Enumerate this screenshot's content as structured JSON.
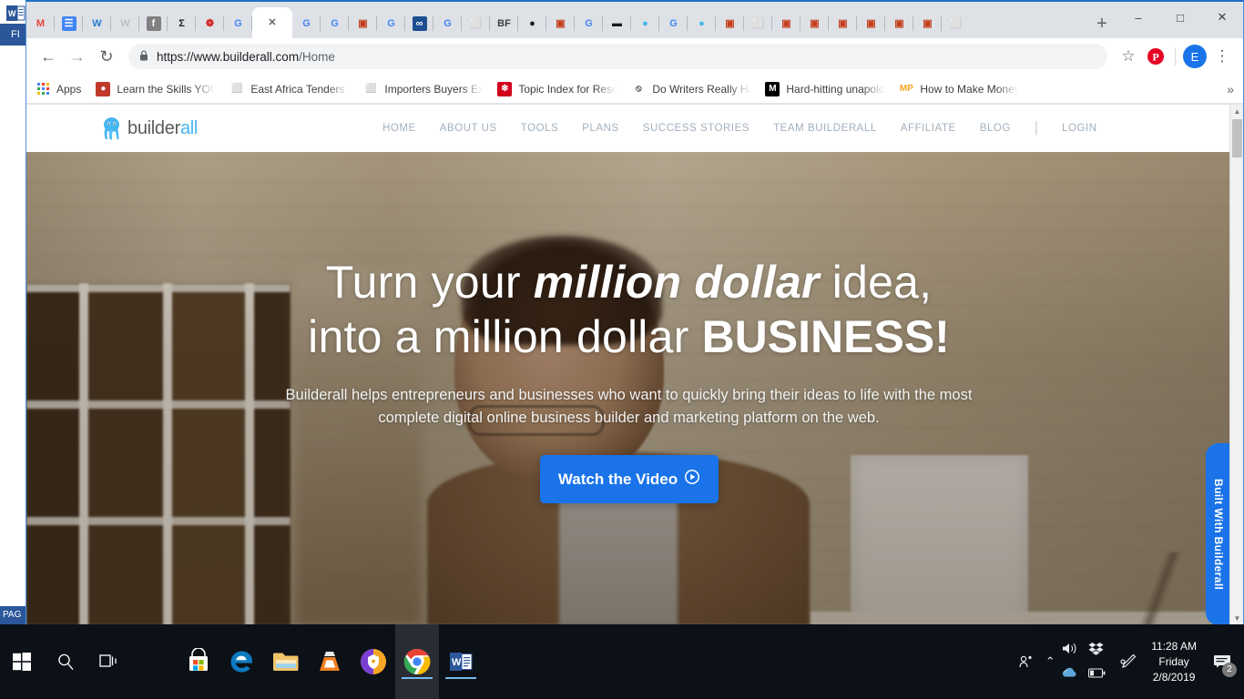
{
  "desktop": {
    "background_window": {
      "app": "Microsoft Word",
      "ribbon_tab_label": "FI",
      "status_label": "PAG"
    }
  },
  "browser": {
    "window_controls": {
      "minimize": "–",
      "maximize": "□",
      "close": "✕"
    },
    "tabs": [
      {
        "favicon": "gmail-icon",
        "glyph": "M",
        "color": "#ea4335",
        "active": false
      },
      {
        "favicon": "google-docs-icon",
        "glyph": "☰",
        "color": "#ffffff",
        "bg": "#4285f4",
        "active": false
      },
      {
        "favicon": "word-icon",
        "glyph": "W",
        "color": "#2b7cd3",
        "active": false
      },
      {
        "favicon": "word-gray-icon",
        "glyph": "W",
        "color": "#bdc1c6",
        "active": false
      },
      {
        "favicon": "facebook-icon",
        "glyph": "f",
        "color": "#ffffff",
        "bg": "#808080",
        "active": false
      },
      {
        "favicon": "chevron-logo-icon",
        "glyph": "Σ",
        "color": "#1a1a1a",
        "active": false
      },
      {
        "favicon": "red-logo-icon",
        "glyph": "❁",
        "color": "#d32f2f",
        "active": false
      },
      {
        "favicon": "google-icon",
        "glyph": "G",
        "color": "#4285f4",
        "active": false
      },
      {
        "favicon": "close-icon",
        "glyph": "✕",
        "color": "#5f6368",
        "active": true
      },
      {
        "favicon": "google-icon",
        "glyph": "G",
        "color": "#4285f4",
        "active": false
      },
      {
        "favicon": "google-icon",
        "glyph": "G",
        "color": "#4285f4",
        "active": false
      },
      {
        "favicon": "powerpoint-icon",
        "glyph": "▣",
        "color": "#c43e1c",
        "active": false
      },
      {
        "favicon": "google-icon",
        "glyph": "G",
        "color": "#4285f4",
        "active": false
      },
      {
        "favicon": "infinity-icon",
        "glyph": "∞",
        "color": "#ffffff",
        "bg": "#1d4f91",
        "active": false
      },
      {
        "favicon": "google-icon",
        "glyph": "G",
        "color": "#4285f4",
        "active": false
      },
      {
        "favicon": "blank-page-icon",
        "glyph": "⬜",
        "color": "#9aa0a6",
        "active": false
      },
      {
        "favicon": "bigfoot-icon",
        "glyph": "BF",
        "color": "#3c4043",
        "active": false
      },
      {
        "favicon": "ninja-icon",
        "glyph": "●",
        "color": "#1a1a1a",
        "active": false
      },
      {
        "favicon": "powerpoint-icon",
        "glyph": "▣",
        "color": "#c43e1c",
        "active": false
      },
      {
        "favicon": "google-icon",
        "glyph": "G",
        "color": "#4285f4",
        "active": false
      },
      {
        "favicon": "dark-logo-icon",
        "glyph": "▬",
        "color": "#1a1a1a",
        "active": false
      },
      {
        "favicon": "builderall-icon",
        "glyph": "●",
        "color": "#45b6f0",
        "active": false
      },
      {
        "favicon": "google-icon",
        "glyph": "G",
        "color": "#4285f4",
        "active": false
      },
      {
        "favicon": "builderall-icon",
        "glyph": "●",
        "color": "#45b6f0",
        "active": false
      },
      {
        "favicon": "powerpoint-icon",
        "glyph": "▣",
        "color": "#c43e1c",
        "active": false
      },
      {
        "favicon": "blank-page-icon",
        "glyph": "⬜",
        "color": "#9aa0a6",
        "active": false
      },
      {
        "favicon": "powerpoint-icon",
        "glyph": "▣",
        "color": "#c43e1c",
        "active": false
      },
      {
        "favicon": "powerpoint-icon",
        "glyph": "▣",
        "color": "#c43e1c",
        "active": false
      },
      {
        "favicon": "powerpoint-icon",
        "glyph": "▣",
        "color": "#c43e1c",
        "active": false
      },
      {
        "favicon": "powerpoint-icon",
        "glyph": "▣",
        "color": "#c43e1c",
        "active": false
      },
      {
        "favicon": "powerpoint-icon",
        "glyph": "▣",
        "color": "#c43e1c",
        "active": false
      },
      {
        "favicon": "powerpoint-icon",
        "glyph": "▣",
        "color": "#c43e1c",
        "active": false
      },
      {
        "favicon": "blank-page-icon",
        "glyph": "⬜",
        "color": "#9aa0a6",
        "active": false
      }
    ],
    "new_tab_label": "+",
    "toolbar": {
      "back": "←",
      "forward": "→",
      "reload": "↻",
      "lock_icon": "🔒",
      "url_host": "https://www.builderall.com",
      "url_path": "/Home",
      "bookmark_star": "☆",
      "pinterest_label": "P",
      "profile_initial": "E",
      "menu": "⋮"
    },
    "bookmarks": {
      "apps_label": "Apps",
      "overflow": "»",
      "items": [
        {
          "label": "Learn the Skills YOU ",
          "icon": "red-circle-icon",
          "glyph": "●",
          "fg": "#ffffff",
          "bg": "#c0392b"
        },
        {
          "label": "East Africa Tenders -",
          "icon": "page-icon",
          "glyph": "⬜",
          "fg": "#9aa0a6",
          "bg": "transparent"
        },
        {
          "label": "Importers Buyers Exp",
          "icon": "page-icon",
          "glyph": "⬜",
          "fg": "#9aa0a6",
          "bg": "transparent"
        },
        {
          "label": "Topic Index for Resou",
          "icon": "red-square-icon",
          "glyph": "❄",
          "fg": "#ffffff",
          "bg": "#d0021b"
        },
        {
          "label": "Do Writers Really Hav",
          "icon": "no-entry-icon",
          "glyph": "⦸",
          "fg": "#3c4043",
          "bg": "transparent"
        },
        {
          "label": "Hard-hitting unapolo",
          "icon": "medium-icon",
          "glyph": "M",
          "fg": "#ffffff",
          "bg": "#000000"
        },
        {
          "label": "How to Make Money",
          "icon": "mp-icon",
          "glyph": "MP",
          "fg": "#f5a623",
          "bg": "#ffffff"
        }
      ]
    },
    "scrollbar": {
      "up_arrow": "▲",
      "down_arrow": "▼"
    }
  },
  "site": {
    "brand": {
      "part1": "builder",
      "part2": "all",
      "logo_icon": "octopus-icon"
    },
    "nav": [
      {
        "label": "HOME"
      },
      {
        "label": "ABOUT US"
      },
      {
        "label": "TOOLS"
      },
      {
        "label": "PLANS"
      },
      {
        "label": "SUCCESS STORIES"
      },
      {
        "label": "TEAM BUILDERALL"
      },
      {
        "label": "AFFILIATE"
      },
      {
        "label": "BLOG"
      }
    ],
    "nav_divider": "|",
    "login_label": "LOGIN",
    "hero": {
      "headline_line1_a": "Turn your ",
      "headline_line1_em": "million dollar",
      "headline_line1_b": " idea,",
      "headline_line2_a": "into a million dollar ",
      "headline_line2_strong": "BUSINESS!",
      "subtitle": "Builderall helps entrepreneurs and businesses who want to quickly bring their ideas to life with the most complete digital online business builder and marketing platform on the web.",
      "cta_label": "Watch the Video",
      "cta_icon": "▶",
      "accent_color": "#1a73e8"
    },
    "side_tab_label": "Built With Builderall"
  },
  "taskbar": {
    "start_label": "⊞",
    "search_label": "⌕",
    "taskview_label": "⌸",
    "apps": [
      {
        "name": "microsoft-store-icon",
        "glyph": "▣",
        "running": false
      },
      {
        "name": "microsoft-edge-icon",
        "glyph": "e",
        "running": false
      },
      {
        "name": "file-explorer-icon",
        "glyph": "⬛",
        "running": false
      },
      {
        "name": "vlc-media-player-icon",
        "glyph": "▲",
        "running": false
      },
      {
        "name": "avast-browser-icon",
        "glyph": "●",
        "running": false
      },
      {
        "name": "google-chrome-icon",
        "glyph": "●",
        "running": true,
        "active": true
      },
      {
        "name": "microsoft-word-icon",
        "glyph": "W",
        "running": true,
        "active": false
      }
    ],
    "tray": {
      "people_icon": "⚹",
      "chevron_up": "⌃",
      "volume_icon": "🔊",
      "dropbox_icon": "❖",
      "onedrive_icon": "☁",
      "battery_icon": "▭",
      "pen_icon": "✎",
      "time": "11:28 AM",
      "day": "Friday",
      "date": "2/8/2019",
      "notifications_glyph": "▭",
      "notifications_count": "2"
    }
  }
}
